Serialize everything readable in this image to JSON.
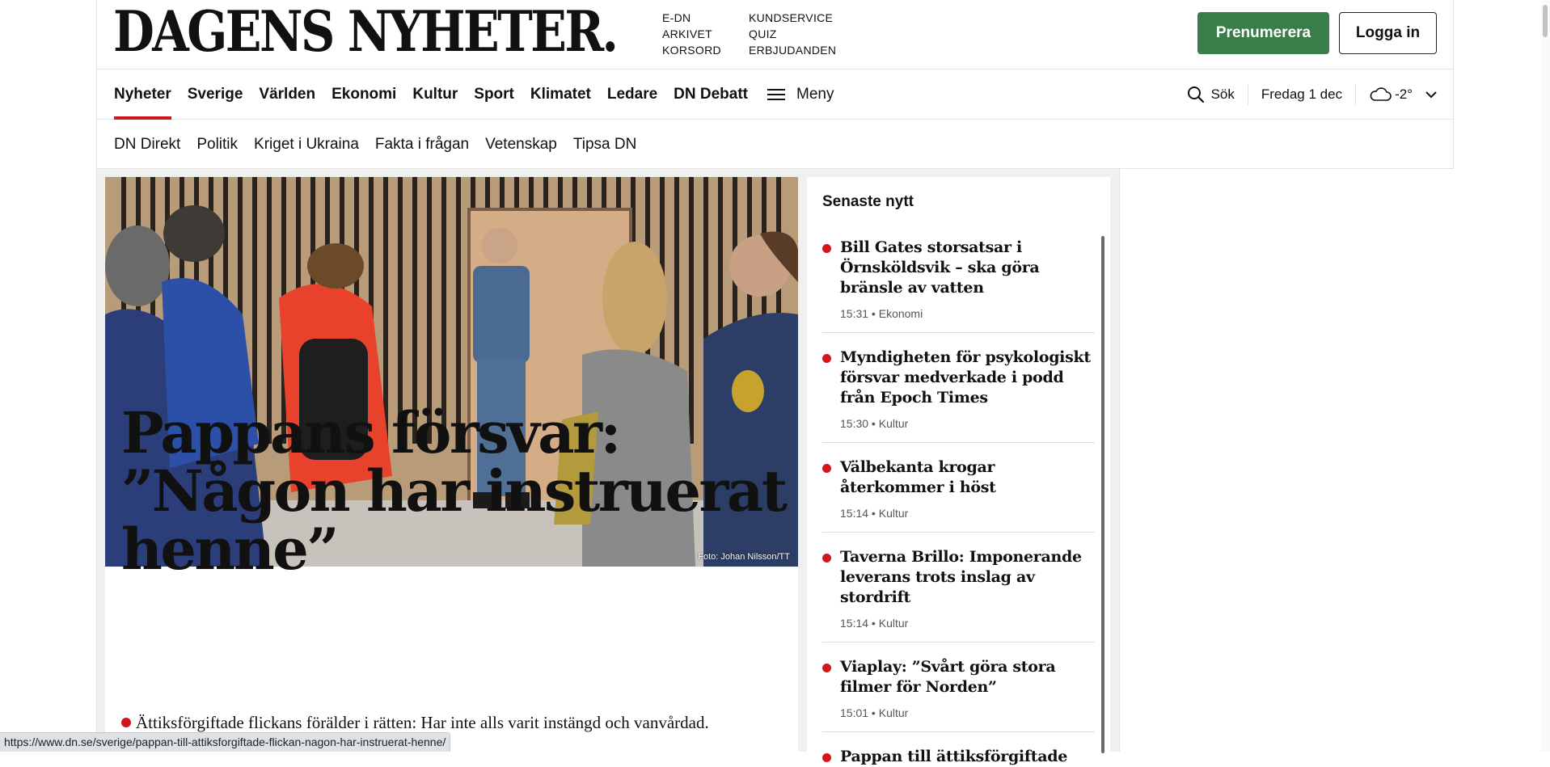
{
  "header": {
    "logo": "DAGENS NYHETER.",
    "quicklinks_col1": [
      "E-DN",
      "ARKIVET",
      "KORSORD"
    ],
    "quicklinks_col2": [
      "KUNDSERVICE",
      "QUIZ",
      "ERBJUDANDEN"
    ],
    "subscribe_label": "Prenumerera",
    "login_label": "Logga in",
    "subscribe_color": "#3a7d4a"
  },
  "mainnav": {
    "items": [
      "Nyheter",
      "Sverige",
      "Världen",
      "Ekonomi",
      "Kultur",
      "Sport",
      "Klimatet",
      "Ledare",
      "DN Debatt"
    ],
    "active": "Nyheter",
    "menu_label": "Meny",
    "search_label": "Sök",
    "date": "Fredag 1 dec",
    "temperature": "-2°",
    "accent_color": "#d2161e"
  },
  "subnav": {
    "items": [
      "DN Direkt",
      "Politik",
      "Kriget i Ukraina",
      "Fakta i frågan",
      "Vetenskap",
      "Tipsa DN"
    ]
  },
  "hero": {
    "photo_credit": "Foto: Johan Nilsson/TT",
    "headline": "Pappans försvar: ”Någon har instruerat henne”",
    "lead": "Ättiksförgiftade flickans förälder i rätten: Har inte alls varit instängd och vanvårdad."
  },
  "latest": {
    "title": "Senaste nytt",
    "items": [
      {
        "title": "Bill Gates storsatsar i Örnsköldsvik – ska göra bränsle av vatten",
        "time": "15:31",
        "section": "Ekonomi"
      },
      {
        "title": "Myndigheten för psykologiskt försvar medverkade i podd från Epoch Times",
        "time": "15:30",
        "section": "Kultur"
      },
      {
        "title": "Välbekanta krogar återkommer i höst",
        "time": "15:14",
        "section": "Kultur"
      },
      {
        "title": "Taverna Brillo: Imponerande leverans trots inslag av stordrift",
        "time": "15:14",
        "section": "Kultur"
      },
      {
        "title": "Viaplay: ”Svårt göra stora filmer för Norden”",
        "time": "15:01",
        "section": "Kultur"
      },
      {
        "title": "Pappan till ättiksförgiftade",
        "time": "",
        "section": ""
      }
    ]
  },
  "status_url": "https://www.dn.se/sverige/pappan-till-attiksforgiftade-flickan-nagon-har-instruerat-henne/"
}
